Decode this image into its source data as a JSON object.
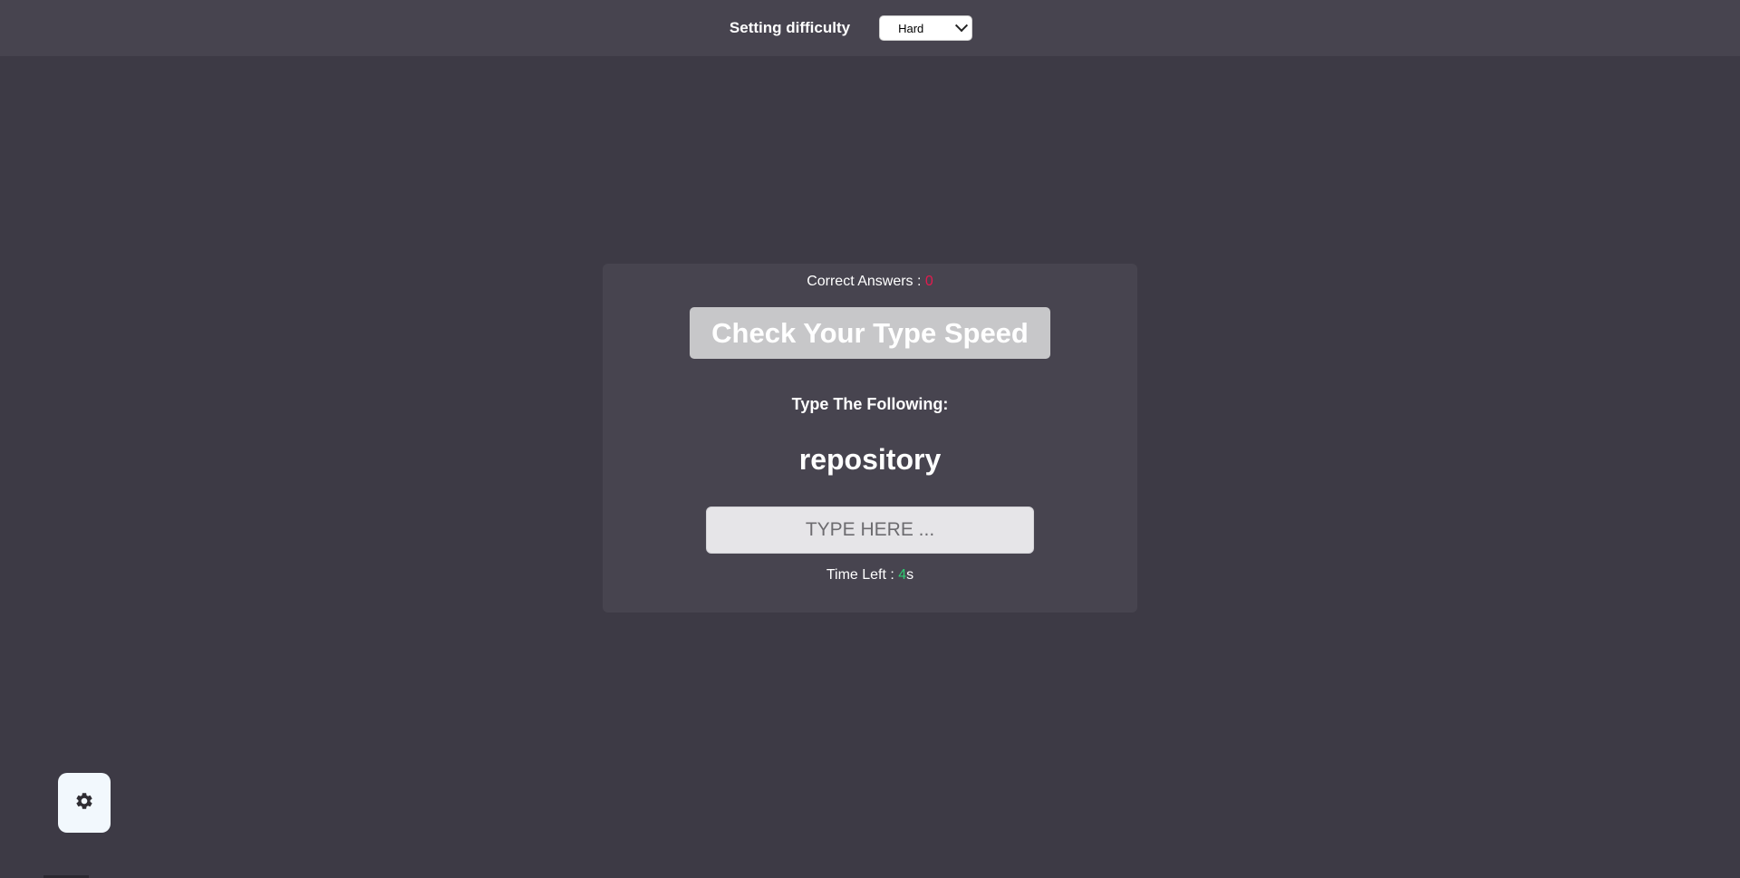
{
  "header": {
    "label": "Setting difficulty",
    "difficulty_selected": "Hard"
  },
  "game": {
    "score_label": "Correct Answers :",
    "score_value": "0",
    "title": "Check Your Type Speed",
    "prompt": "Type The Following:",
    "word": "repository",
    "input_placeholder": "TYPE HERE ...",
    "input_value": "",
    "time_label": "Time Left :",
    "time_value": "4",
    "time_unit": "s"
  },
  "settings": {
    "icon": "gear-icon"
  },
  "colors": {
    "background": "#3d3a45",
    "panel": "#47444f",
    "score_accent": "#e31b4f",
    "time_accent": "#2ecc71"
  }
}
